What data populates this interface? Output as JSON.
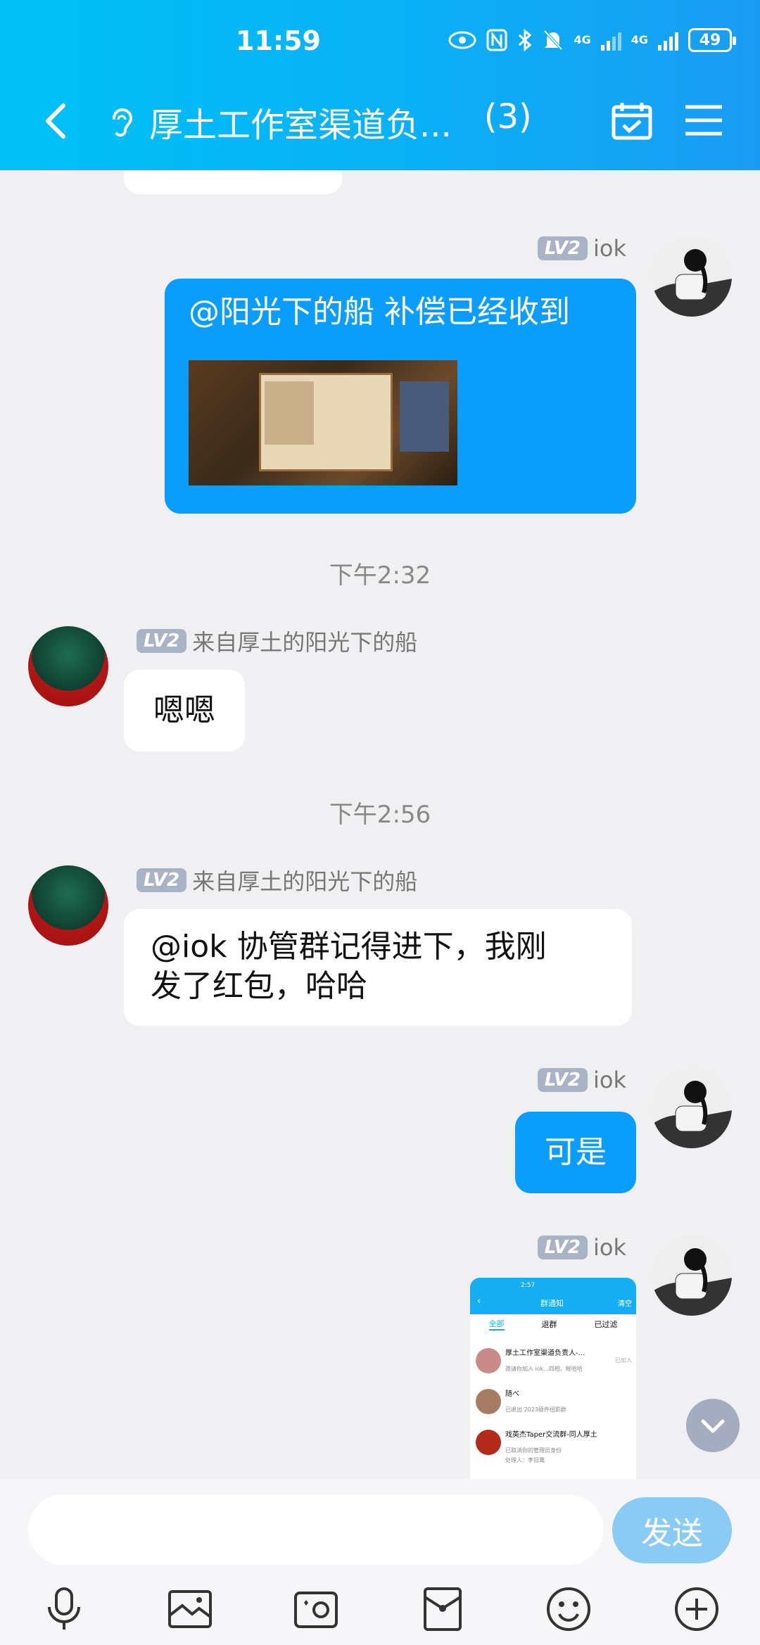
{
  "status_bar": {
    "time": "11:59",
    "net1": "4G",
    "net2": "4G",
    "battery": "49"
  },
  "header": {
    "title": "厚土工作室渠道负...",
    "member_count": "(3)"
  },
  "messages": {
    "m1": {
      "level": "LV2",
      "name": "iok",
      "text": "@阳光下的船 补偿已经收到"
    },
    "ts1": "下午2:32",
    "m2": {
      "level": "LV2",
      "name": "来自厚土的阳光下的船",
      "text": "嗯嗯"
    },
    "ts2": "下午2:56",
    "m3": {
      "level": "LV2",
      "name": "来自厚土的阳光下的船",
      "line1": "@iok 协管群记得进下，我刚",
      "line2": "发了红包，哈哈"
    },
    "m4": {
      "level": "LV2",
      "name": "iok",
      "text": "可是"
    },
    "m5": {
      "level": "LV2",
      "name": "iok"
    }
  },
  "screenshot_preview": {
    "time": "2:57",
    "title": "群通知",
    "clear": "清空",
    "tabs": [
      "全部",
      "退群",
      "已过滤"
    ],
    "items": [
      {
        "title": "厚土工作室渠道负责人-...",
        "sub": "邀请你加入 iok...四相、帐哈哈",
        "status": "已加入"
      },
      {
        "title": "随べ",
        "sub": "已退出 2023硕件纽影群",
        "status": ""
      },
      {
        "title": "戏英杰Taper交流群-同人厚土",
        "sub": "已取消你的管理员身份",
        "status": ""
      },
      {
        "title": "处理人：李旧鹰",
        "sub": "",
        "status": ""
      }
    ]
  },
  "input_bar": {
    "placeholder": "",
    "send_label": "发送"
  },
  "colors": {
    "header_start": "#00c2f7",
    "header_end": "#1a9cf3",
    "my_bubble": "#0a9dfb",
    "send_button": "#8acbf6"
  }
}
